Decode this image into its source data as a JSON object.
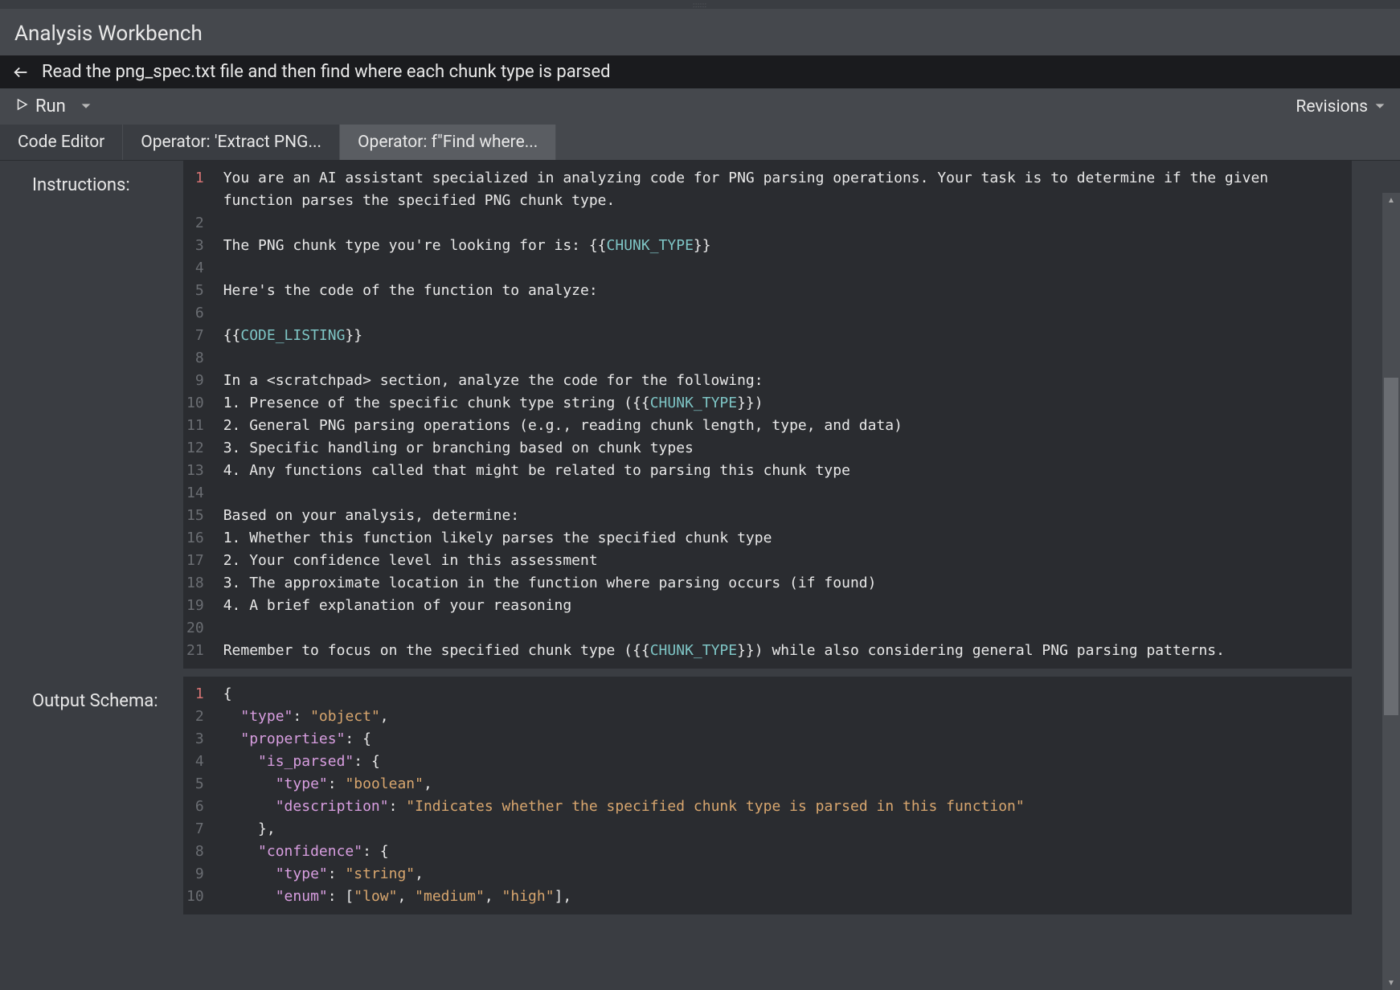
{
  "header": {
    "title": "Analysis Workbench"
  },
  "prompt": {
    "text": "Read the png_spec.txt file and then find where each chunk type is parsed"
  },
  "toolbar": {
    "run_label": "Run",
    "revisions_label": "Revisions"
  },
  "tabs": [
    {
      "label": "Code Editor",
      "active": false
    },
    {
      "label": "Operator: 'Extract PNG...",
      "active": false
    },
    {
      "label": "Operator: f\"Find where...",
      "active": true
    }
  ],
  "sections": {
    "instructions": {
      "label": "Instructions:",
      "lines": [
        {
          "n": 1,
          "segments": [
            {
              "t": "You are an AI assistant specialized in analyzing code for PNG parsing operations. Your task is to determine if the given function parses the specified PNG chunk type.",
              "c": "plain"
            }
          ]
        },
        {
          "n": 2,
          "segments": []
        },
        {
          "n": 3,
          "segments": [
            {
              "t": "The PNG chunk type you're looking for is: ",
              "c": "plain"
            },
            {
              "t": "{{",
              "c": "plain"
            },
            {
              "t": "CHUNK_TYPE",
              "c": "var"
            },
            {
              "t": "}}",
              "c": "plain"
            }
          ]
        },
        {
          "n": 4,
          "segments": []
        },
        {
          "n": 5,
          "segments": [
            {
              "t": "Here's the code of the function to analyze:",
              "c": "plain"
            }
          ]
        },
        {
          "n": 6,
          "segments": []
        },
        {
          "n": 7,
          "segments": [
            {
              "t": "{{",
              "c": "plain"
            },
            {
              "t": "CODE_LISTING",
              "c": "var"
            },
            {
              "t": "}}",
              "c": "plain"
            }
          ]
        },
        {
          "n": 8,
          "segments": []
        },
        {
          "n": 9,
          "segments": [
            {
              "t": "In a <scratchpad> section, analyze the code for the following:",
              "c": "plain"
            }
          ]
        },
        {
          "n": 10,
          "segments": [
            {
              "t": "1. Presence of the specific chunk type string (",
              "c": "plain"
            },
            {
              "t": "{{",
              "c": "plain"
            },
            {
              "t": "CHUNK_TYPE",
              "c": "var"
            },
            {
              "t": "}}",
              "c": "plain"
            },
            {
              "t": ")",
              "c": "plain"
            }
          ]
        },
        {
          "n": 11,
          "segments": [
            {
              "t": "2. General PNG parsing operations (e.g., reading chunk length, type, and data)",
              "c": "plain"
            }
          ]
        },
        {
          "n": 12,
          "segments": [
            {
              "t": "3. Specific handling or branching based on chunk types",
              "c": "plain"
            }
          ]
        },
        {
          "n": 13,
          "segments": [
            {
              "t": "4. Any functions called that might be related to parsing this chunk type",
              "c": "plain"
            }
          ]
        },
        {
          "n": 14,
          "segments": []
        },
        {
          "n": 15,
          "segments": [
            {
              "t": "Based on your analysis, determine:",
              "c": "plain"
            }
          ]
        },
        {
          "n": 16,
          "segments": [
            {
              "t": "1. Whether this function likely parses the specified chunk type",
              "c": "plain"
            }
          ]
        },
        {
          "n": 17,
          "segments": [
            {
              "t": "2. Your confidence level in this assessment",
              "c": "plain"
            }
          ]
        },
        {
          "n": 18,
          "segments": [
            {
              "t": "3. The approximate location in the function where parsing occurs (if found)",
              "c": "plain"
            }
          ]
        },
        {
          "n": 19,
          "segments": [
            {
              "t": "4. A brief explanation of your reasoning",
              "c": "plain"
            }
          ]
        },
        {
          "n": 20,
          "segments": []
        },
        {
          "n": 21,
          "segments": [
            {
              "t": "Remember to focus on the specified chunk type (",
              "c": "plain"
            },
            {
              "t": "{{",
              "c": "plain"
            },
            {
              "t": "CHUNK_TYPE",
              "c": "var"
            },
            {
              "t": "}}",
              "c": "plain"
            },
            {
              "t": ") while also considering general PNG parsing patterns.",
              "c": "plain"
            }
          ]
        }
      ]
    },
    "output_schema": {
      "label": "Output Schema:",
      "lines": [
        {
          "n": 1,
          "segments": [
            {
              "t": "{",
              "c": "plain"
            }
          ]
        },
        {
          "n": 2,
          "segments": [
            {
              "t": "  ",
              "c": "plain"
            },
            {
              "t": "\"type\"",
              "c": "key"
            },
            {
              "t": ": ",
              "c": "plain"
            },
            {
              "t": "\"object\"",
              "c": "string"
            },
            {
              "t": ",",
              "c": "plain"
            }
          ]
        },
        {
          "n": 3,
          "segments": [
            {
              "t": "  ",
              "c": "plain"
            },
            {
              "t": "\"properties\"",
              "c": "key"
            },
            {
              "t": ": {",
              "c": "plain"
            }
          ]
        },
        {
          "n": 4,
          "segments": [
            {
              "t": "    ",
              "c": "plain"
            },
            {
              "t": "\"is_parsed\"",
              "c": "key"
            },
            {
              "t": ": {",
              "c": "plain"
            }
          ]
        },
        {
          "n": 5,
          "segments": [
            {
              "t": "      ",
              "c": "plain"
            },
            {
              "t": "\"type\"",
              "c": "key"
            },
            {
              "t": ": ",
              "c": "plain"
            },
            {
              "t": "\"boolean\"",
              "c": "string"
            },
            {
              "t": ",",
              "c": "plain"
            }
          ]
        },
        {
          "n": 6,
          "segments": [
            {
              "t": "      ",
              "c": "plain"
            },
            {
              "t": "\"description\"",
              "c": "key"
            },
            {
              "t": ": ",
              "c": "plain"
            },
            {
              "t": "\"Indicates whether the specified chunk type is parsed in this function\"",
              "c": "string"
            }
          ]
        },
        {
          "n": 7,
          "segments": [
            {
              "t": "    },",
              "c": "plain"
            }
          ]
        },
        {
          "n": 8,
          "segments": [
            {
              "t": "    ",
              "c": "plain"
            },
            {
              "t": "\"confidence\"",
              "c": "key"
            },
            {
              "t": ": {",
              "c": "plain"
            }
          ]
        },
        {
          "n": 9,
          "segments": [
            {
              "t": "      ",
              "c": "plain"
            },
            {
              "t": "\"type\"",
              "c": "key"
            },
            {
              "t": ": ",
              "c": "plain"
            },
            {
              "t": "\"string\"",
              "c": "string"
            },
            {
              "t": ",",
              "c": "plain"
            }
          ]
        },
        {
          "n": 10,
          "segments": [
            {
              "t": "      ",
              "c": "plain"
            },
            {
              "t": "\"enum\"",
              "c": "key"
            },
            {
              "t": ": [",
              "c": "plain"
            },
            {
              "t": "\"low\"",
              "c": "string"
            },
            {
              "t": ", ",
              "c": "plain"
            },
            {
              "t": "\"medium\"",
              "c": "string"
            },
            {
              "t": ", ",
              "c": "plain"
            },
            {
              "t": "\"high\"",
              "c": "string"
            },
            {
              "t": "],",
              "c": "plain"
            }
          ]
        }
      ]
    }
  }
}
